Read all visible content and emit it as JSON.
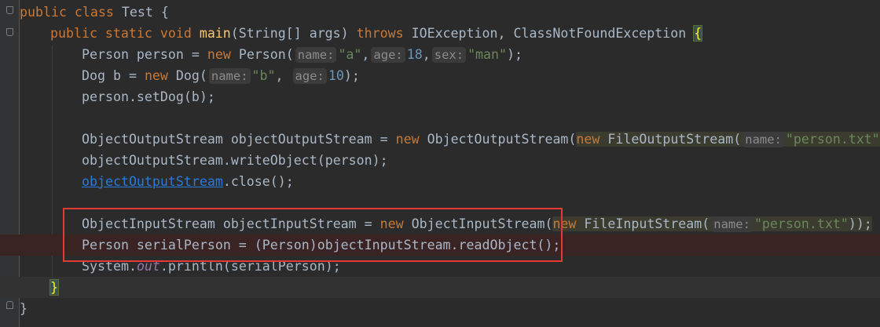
{
  "lines": [
    {
      "k1": "public class ",
      "t1": "Test {"
    },
    {
      "k1": "public static void ",
      "f1": "main",
      "t1": "(String[] args) ",
      "k2": "throws ",
      "t2": "IOException, ClassNotFoundException ",
      "b1": "{"
    },
    {
      "t1": "Person person = ",
      "k1": "new ",
      "t2": "Person(",
      "h1": "name:",
      "s1": "\"a\"",
      "t3": ",",
      "h2": "age:",
      "n1": "18",
      "t4": ",",
      "h3": "sex:",
      "s2": "\"man\"",
      "t5": ");"
    },
    {
      "t1": "Dog b = ",
      "k1": "new ",
      "t2": "Dog(",
      "h1": "name:",
      "s1": "\"b\"",
      "t3": ", ",
      "h2": "age:",
      "n1": "10",
      "t4": ");"
    },
    {
      "t1": "person.setDog(b);"
    },
    {
      "t1": ""
    },
    {
      "t1": "ObjectOutputStream objectOutputStream = ",
      "k1": "new ",
      "t2": "ObjectOutputStream(",
      "k2": "new ",
      "t3": "FileOutputStream(",
      "h1": "name:",
      "s1": "\"person.txt\"",
      "t4": "));"
    },
    {
      "t1": "objectOutputStream.writeObject(person);"
    },
    {
      "u1": "objectOutputStream",
      "t1": ".close();"
    },
    {
      "t1": ""
    },
    {
      "t1": "ObjectInputStream objectInputStream = ",
      "k1": "new ",
      "t2": "ObjectInputStream(",
      "k2": "new ",
      "t3": "FileInputStream(",
      "h1": "name:",
      "s1": "\"person.txt\"",
      "t4": "));"
    },
    {
      "t1": "Person serialPerson = (Person)objectInputStream.readObject();"
    },
    {
      "t1": "System.",
      "st1": "out",
      "t2": ".println(serialPerson);"
    },
    {
      "b1": "}"
    },
    {
      "t1": "}"
    }
  ],
  "colors": {
    "background": "#2b2b2b",
    "gutter": "#313335",
    "keyword": "#cc7832",
    "method": "#ffc66d",
    "string": "#6a8759",
    "number": "#6897bb",
    "highlight_box": "#e53935"
  }
}
